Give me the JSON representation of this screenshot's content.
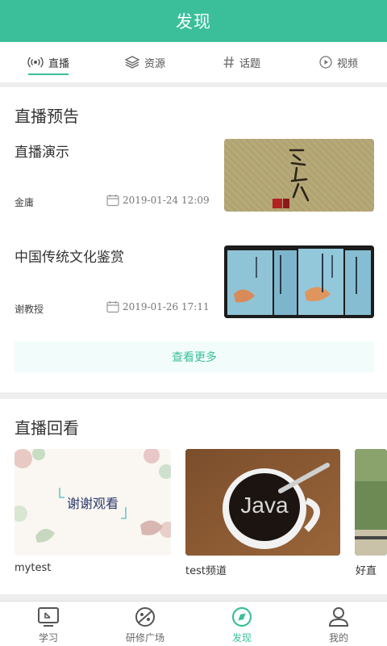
{
  "header": {
    "title": "发现"
  },
  "tabs": [
    {
      "label": "直播",
      "icon": "broadcast-icon",
      "active": true
    },
    {
      "label": "资源",
      "icon": "layers-icon",
      "active": false
    },
    {
      "label": "话题",
      "icon": "hashtag-icon",
      "active": false
    },
    {
      "label": "视频",
      "icon": "play-circle-icon",
      "active": false
    }
  ],
  "preview": {
    "title": "直播预告",
    "items": [
      {
        "title": "直播演示",
        "author": "金庸",
        "date": "2019-01-24 12:09"
      },
      {
        "title": "中国传统文化鉴赏",
        "author": "谢教授",
        "date": "2019-01-26 17:11"
      }
    ],
    "more_label": "查看更多"
  },
  "replay": {
    "title": "直播回看",
    "items": [
      {
        "label": "mytest",
        "thumb_text": "谢谢观看"
      },
      {
        "label": "test频道",
        "thumb_text": "Java"
      },
      {
        "label": "好直"
      }
    ]
  },
  "bottom_nav": [
    {
      "label": "学习",
      "icon": "study-icon",
      "active": false
    },
    {
      "label": "研修广场",
      "icon": "plaza-icon",
      "active": false
    },
    {
      "label": "发现",
      "icon": "compass-icon",
      "active": true
    },
    {
      "label": "我的",
      "icon": "user-icon",
      "active": false
    }
  ],
  "colors": {
    "accent": "#3bbf9a",
    "background": "#eeeeee"
  }
}
